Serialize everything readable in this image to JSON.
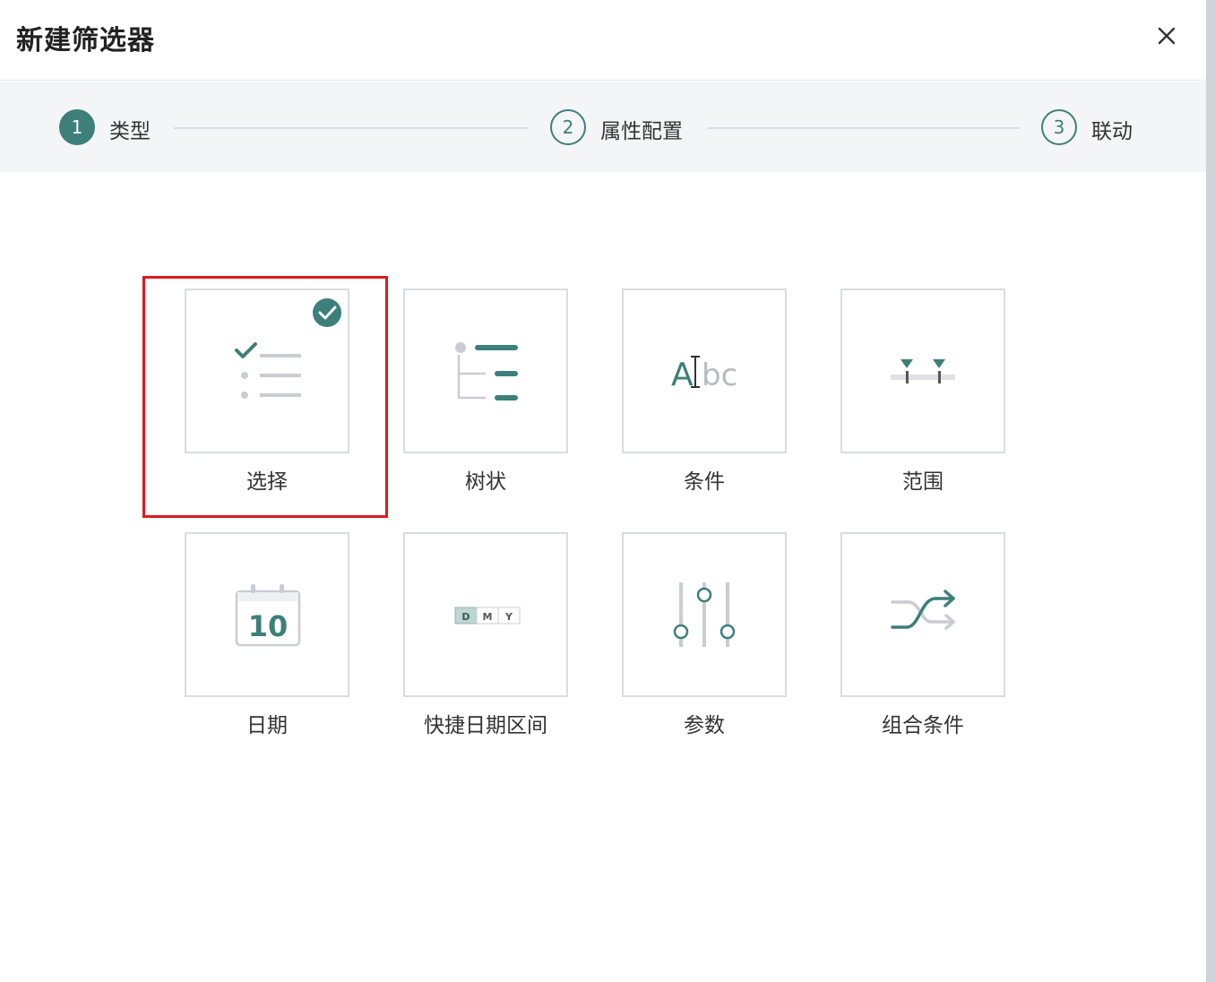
{
  "dialog": {
    "title": "新建筛选器",
    "close_icon": "close-icon"
  },
  "steps": [
    {
      "number": "1",
      "label": "类型",
      "state": "active"
    },
    {
      "number": "2",
      "label": "属性配置",
      "state": "inactive"
    },
    {
      "number": "3",
      "label": "联动",
      "state": "inactive"
    }
  ],
  "colors": {
    "accent": "#3d7f7a",
    "highlight": "#e0191e",
    "icon_gray": "#c9cdd1"
  },
  "types": [
    {
      "label": "选择",
      "icon": "checklist-icon",
      "selected": true
    },
    {
      "label": "树状",
      "icon": "tree-icon",
      "selected": false
    },
    {
      "label": "条件",
      "icon": "text-condition-icon",
      "selected": false,
      "icon_text_a": "A",
      "icon_text_bc": "bc"
    },
    {
      "label": "范围",
      "icon": "range-slider-icon",
      "selected": false
    },
    {
      "label": "日期",
      "icon": "calendar-icon",
      "selected": false,
      "icon_text": "10"
    },
    {
      "label": "快捷日期区间",
      "icon": "quick-date-range-icon",
      "selected": false,
      "icon_d": "D",
      "icon_m": "M",
      "icon_y": "Y"
    },
    {
      "label": "参数",
      "icon": "parameter-sliders-icon",
      "selected": false
    },
    {
      "label": "组合条件",
      "icon": "combine-condition-icon",
      "selected": false
    }
  ]
}
